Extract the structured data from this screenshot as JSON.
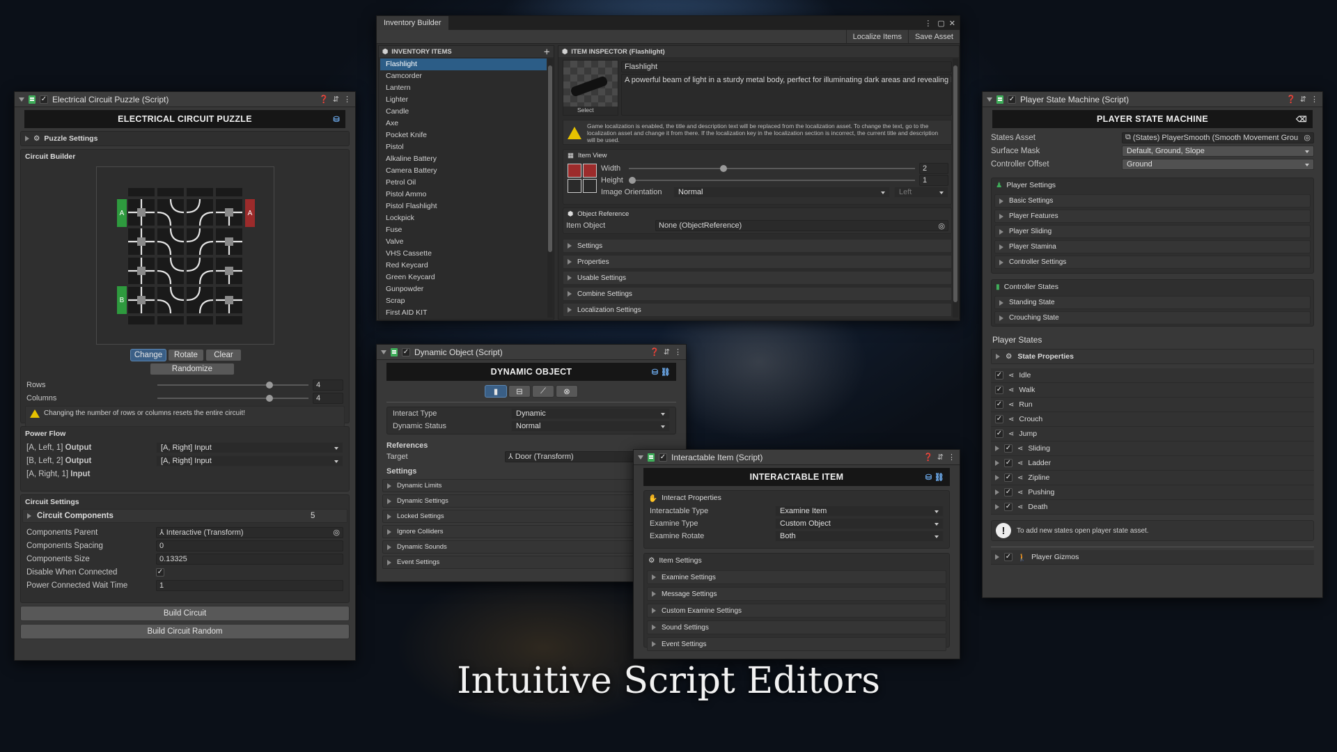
{
  "headline": "Intuitive Script Editors",
  "colors": {
    "accent_blue": "#2c5d87",
    "green": "#2e9a3e",
    "red": "#9c2b2b",
    "warning": "#e6c200"
  },
  "circuit": {
    "title": "Electrical Circuit Puzzle (Script)",
    "banner": "ELECTRICAL CIRCUIT PUZZLE",
    "puzzle_settings": "Puzzle Settings",
    "builder_label": "Circuit Builder",
    "port_a": "A",
    "port_b": "B",
    "buttons": {
      "change": "Change",
      "rotate": "Rotate",
      "clear": "Clear",
      "randomize": "Randomize",
      "build": "Build Circuit",
      "build_random": "Build Circuit Random"
    },
    "rows_label": "Rows",
    "rows_value": "4",
    "columns_label": "Columns",
    "columns_value": "4",
    "slider_fraction": 0.74,
    "warning": "Changing the number of rows or columns resets the entire circuit!",
    "power_flow_label": "Power Flow",
    "flows": [
      {
        "prefix": "[A, Left, 1]",
        "kind": "Output",
        "value": "[A, Right] Input"
      },
      {
        "prefix": "[B, Left, 2]",
        "kind": "Output",
        "value": "[A, Right] Input"
      },
      {
        "prefix": "[A, Right, 1]",
        "kind": "Input",
        "value": ""
      }
    ],
    "settings_label": "Circuit Settings",
    "components_label": "Circuit Components",
    "components_count": "5",
    "fields": [
      {
        "label": "Components Parent",
        "value": "Interactive (Transform)"
      },
      {
        "label": "Components Spacing",
        "value": "0"
      },
      {
        "label": "Components Size",
        "value": "0.13325"
      },
      {
        "label": "Disable When Connected",
        "value": "✓"
      },
      {
        "label": "Power Connected Wait Time",
        "value": "1"
      }
    ]
  },
  "inventory": {
    "title": "Inventory Builder",
    "toolbar": {
      "localize": "Localize Items",
      "save": "Save Asset"
    },
    "list_header": "INVENTORY ITEMS",
    "items": [
      "Flashlight",
      "Camcorder",
      "Lantern",
      "Lighter",
      "Candle",
      "Axe",
      "Pocket Knife",
      "Pistol",
      "Alkaline Battery",
      "Camera Battery",
      "Petrol Oil",
      "Pistol Ammo",
      "Pistol Flashlight",
      "Lockpick",
      "Fuse",
      "Valve",
      "VHS Cassette",
      "Red Keycard",
      "Green Keycard",
      "Gunpowder",
      "Scrap",
      "First AID KIT"
    ],
    "inspector_header": "ITEM INSPECTOR (Flashlight)",
    "item_name": "Flashlight",
    "item_desc": "A powerful beam of light in a sturdy metal body, perfect for illuminating dark areas and revealing hi",
    "select_label": "Select",
    "localization_warning": "Game localization is enabled, the title and description text will be replaced from the localization asset. To change the text, go to the localization asset and change it from there. If the localization key in the localization section is incorrect, the current title and description will be used.",
    "item_view_label": "Item View",
    "width_label": "Width",
    "width_value": "2",
    "height_label": "Height",
    "height_value": "1",
    "width_fraction": 0.33,
    "height_fraction": 0.0,
    "orientation_label": "Image Orientation",
    "orientation_value": "Normal",
    "orientation_side": "Left",
    "object_ref_label": "Object Reference",
    "item_object_label": "Item Object",
    "item_object_value": "None (ObjectReference)",
    "foldouts": [
      "Settings",
      "Properties",
      "Usable Settings",
      "Combine Settings",
      "Localization Settings"
    ]
  },
  "dynamic": {
    "title": "Dynamic Object (Script)",
    "banner": "DYNAMIC OBJECT",
    "interact_type_label": "Interact Type",
    "interact_type_value": "Dynamic",
    "status_label": "Dynamic Status",
    "status_value": "Normal",
    "references_label": "References",
    "target_label": "Target",
    "target_value": "Door (Transform)",
    "settings_label": "Settings",
    "foldouts": [
      "Dynamic Limits",
      "Dynamic Settings",
      "Locked Settings",
      "Ignore Colliders",
      "Dynamic Sounds",
      "Event Settings"
    ]
  },
  "interactable": {
    "title": "Interactable Item (Script)",
    "banner": "INTERACTABLE ITEM",
    "props_label": "Interact Properties",
    "fields": [
      {
        "label": "Interactable Type",
        "value": "Examine Item"
      },
      {
        "label": "Examine Type",
        "value": "Custom Object"
      },
      {
        "label": "Examine Rotate",
        "value": "Both"
      }
    ],
    "item_settings_label": "Item Settings",
    "foldouts": [
      "Examine Settings",
      "Message Settings",
      "Custom Examine Settings",
      "Sound Settings",
      "Event Settings"
    ]
  },
  "player": {
    "title": "Player State Machine (Script)",
    "banner": "PLAYER STATE MACHINE",
    "fields": [
      {
        "label": "States Asset",
        "value": "(States) PlayerSmooth (Smooth Movement Grou",
        "type": "obj"
      },
      {
        "label": "Surface Mask",
        "value": "Default, Ground, Slope",
        "type": "dd"
      },
      {
        "label": "Controller Offset",
        "value": "Ground",
        "type": "dd"
      }
    ],
    "player_settings_label": "Player Settings",
    "player_settings": [
      "Basic Settings",
      "Player Features",
      "Player Sliding",
      "Player Stamina",
      "Controller Settings"
    ],
    "controller_states_label": "Controller States",
    "controller_states": [
      "Standing State",
      "Crouching State"
    ],
    "player_states_label": "Player States",
    "state_properties_label": "State Properties",
    "states": [
      {
        "name": "Idle",
        "fold": false
      },
      {
        "name": "Walk",
        "fold": false
      },
      {
        "name": "Run",
        "fold": false
      },
      {
        "name": "Crouch",
        "fold": false
      },
      {
        "name": "Jump",
        "fold": false
      },
      {
        "name": "Sliding",
        "fold": true
      },
      {
        "name": "Ladder",
        "fold": true
      },
      {
        "name": "Zipline",
        "fold": true
      },
      {
        "name": "Pushing",
        "fold": true
      },
      {
        "name": "Death",
        "fold": true
      }
    ],
    "add_info": "To add new states open player state asset.",
    "gizmos_label": "Player Gizmos"
  }
}
